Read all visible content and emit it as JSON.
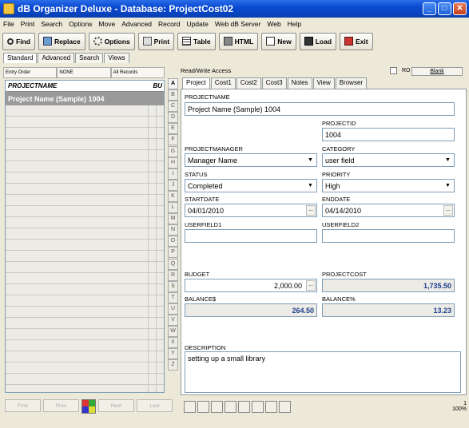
{
  "window": {
    "title": "dB Organizer Deluxe - Database: ProjectCost02"
  },
  "menu": [
    "File",
    "Print",
    "Search",
    "Options",
    "Move",
    "Advanced",
    "Record",
    "Update",
    "Web dB Server",
    "Web",
    "Help"
  ],
  "toolbar": {
    "find": "Find",
    "replace": "Replace",
    "options": "Options",
    "print": "Print",
    "table": "Table",
    "html": "HTML",
    "new": "New",
    "load": "Load",
    "exit": "Exit"
  },
  "left_tabs": [
    "Standard",
    "Advanced",
    "Search",
    "Views"
  ],
  "sort_bar": [
    "Entry Order",
    "NONE",
    "All Records"
  ],
  "list": {
    "header": "PROJECTNAME",
    "header2": "BU",
    "selected": "Project Name (Sample) 1004"
  },
  "nav_buttons": [
    "First",
    "Prev",
    "Next",
    "Last"
  ],
  "alphabet": [
    "A",
    "B",
    "C",
    "D",
    "E",
    "F",
    "G",
    "H",
    "I",
    "J",
    "K",
    "L",
    "M",
    "N",
    "O",
    "P",
    "Q",
    "R",
    "S",
    "T",
    "U",
    "V",
    "W",
    "X",
    "Y",
    "Z"
  ],
  "access": {
    "label": "Read/Write Access",
    "ro": "RO",
    "blank": "Blank"
  },
  "record_tabs": [
    "Project",
    "Cost1",
    "Cost2",
    "Cost3",
    "Notes",
    "View",
    "Browser"
  ],
  "fields": {
    "projectname": {
      "label": "PROJECTNAME",
      "value": "Project Name (Sample) 1004"
    },
    "projectid": {
      "label": "PROJECTID",
      "value": "1004"
    },
    "projectmanager": {
      "label": "PROJECTMANAGER",
      "value": "Manager Name"
    },
    "category": {
      "label": "CATEGORY",
      "value": "user field"
    },
    "status": {
      "label": "STATUS",
      "value": "Completed"
    },
    "priority": {
      "label": "PRIORITY",
      "value": "High"
    },
    "startdate": {
      "label": "STARTDATE",
      "value": "04/01/2010"
    },
    "enddate": {
      "label": "ENDDATE",
      "value": "04/14/2010"
    },
    "userfield1": {
      "label": "USERFIELD1",
      "value": ""
    },
    "userfield2": {
      "label": "USERFIELD2",
      "value": ""
    },
    "budget": {
      "label": "BUDGET",
      "value": "2,000.00"
    },
    "projectcost": {
      "label": "PROJECTCOST",
      "value": "1,735.50"
    },
    "balance": {
      "label": "BALANCE$",
      "value": "264.50"
    },
    "balancepct": {
      "label": "BALANCE%",
      "value": "13.23"
    },
    "description": {
      "label": "DESCRIPTION",
      "value": "setting up a small library"
    }
  },
  "status": {
    "record": "1",
    "zoom": "100%"
  }
}
